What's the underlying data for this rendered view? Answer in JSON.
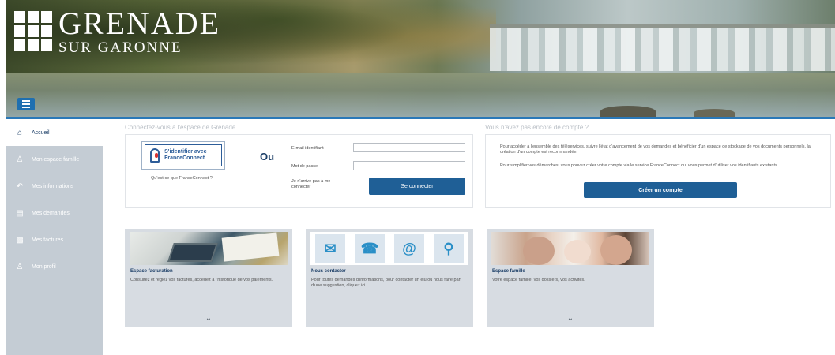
{
  "header": {
    "logo_line1": "GRENADE",
    "logo_line2": "SUR GARONNE",
    "menu_icon": "hamburger-icon",
    "accent_color": "#2a78b8"
  },
  "sidebar": {
    "items": [
      {
        "label": "Accueil",
        "icon": "home-icon",
        "active": true
      },
      {
        "label": "Mon espace famille",
        "icon": "user-icon",
        "active": false
      },
      {
        "label": "Mes informations",
        "icon": "arrow-icon",
        "active": false
      },
      {
        "label": "Mes demandes",
        "icon": "card-icon",
        "active": false
      },
      {
        "label": "Mes factures",
        "icon": "wallet-icon",
        "active": false
      },
      {
        "label": "Mon profil",
        "icon": "person-icon",
        "active": false
      }
    ]
  },
  "login": {
    "section_title": "Connectez-vous à l'espace de Grenade",
    "franceconnect_label": "S'identifier avec FranceConnect",
    "franceconnect_help": "Qu'est-ce que FranceConnect ?",
    "or_label": "Ou",
    "email_label": "E-mail identifiant",
    "email_value": "",
    "password_label": "Mot de passe",
    "password_value": "",
    "forgot_label": "Je n'arrive pas à me connecter",
    "connect_button": "Se connecter"
  },
  "create": {
    "section_title": "Vous n'avez pas encore de compte ?",
    "text1": "Pour accéder à l'ensemble des téléservices, suivre l'état d'avancement de vos demandes et bénéficier d'un espace de stockage de vos documents personnels, la création d'un compte est recommandée.",
    "text2": "Pour simplifier vos démarches, vous pouvez créer votre compte via le service FranceConnect qui vous permet d'utiliser vos identifiants existants.",
    "button": "Créer un compte",
    "button_color": "#1f5f96"
  },
  "cards": [
    {
      "title": "Espace facturation",
      "description": "Consultez et réglez vos factures, accédez à l'historique de vos paiements.",
      "chevron": "chevron-down-icon"
    },
    {
      "title": "Nous contacter",
      "description": "Pour toutes demandes d'informations, pour contacter un élu ou nous faire part d'une suggestion, cliquez ici.",
      "chevron": "chevron-down-icon"
    },
    {
      "title": "Espace famille",
      "description": "Votre espace famille, vos dossiers, vos activités.",
      "chevron": "chevron-down-icon"
    }
  ]
}
